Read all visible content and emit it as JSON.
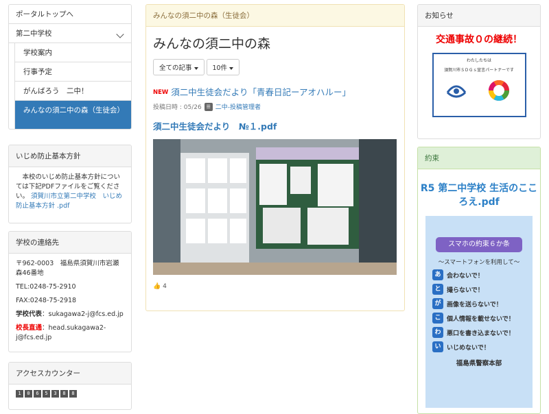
{
  "nav": {
    "portal": "ポータルトップへ",
    "school": "第二中学校",
    "items": [
      "学校案内",
      "行事予定",
      "がんばろう　二中！",
      "みんなの須二中の森（生徒会）"
    ]
  },
  "ijime": {
    "title": "いじめ防止基本方針",
    "text": "　本校のいじめ防止基本方針については下記PDFファイルをご覧ください。",
    "link": "須賀川市立第二中学校　いじめ防止基本方針 .pdf"
  },
  "contact": {
    "title": "学校の連絡先",
    "address": "〒962-0003　福島県須賀川市岩瀬森46番地",
    "tel": "TEL:0248-75-2910",
    "fax": "FAX:0248-75-2918",
    "rep_label": "学校代表",
    "rep_mail": "：sukagawa2-j@fcs.ed.jp",
    "head_label": "校長直通",
    "head_mail": "：head.sukagawa2-j@fcs.ed.jp"
  },
  "counter": {
    "title": "アクセスカウンター",
    "digits": [
      "1",
      "0",
      "6",
      "5",
      "3",
      "8",
      "8"
    ]
  },
  "main": {
    "breadcrumb": "みんなの須二中の森（生徒会）",
    "title": "みんなの須二中の森",
    "filter_all": "全ての記事",
    "filter_count": "10件",
    "new_badge": "NEW",
    "article_title": "須二中生徒会だより「青春日記ーアオハルー」",
    "posted": "投稿日時 : 05/26",
    "author": "二中-投稿管理者",
    "pdf": "須二中生徒会だより　№１.pdf",
    "likes": "4"
  },
  "notice": {
    "title": "お知らせ",
    "headline": "交通事故０の継続！",
    "sdgs_line1": "わたしたちは",
    "sdgs_line2": "須賀川市ＳＤＧｓ宣言パートナーです"
  },
  "promise": {
    "title": "約束",
    "headline": "R5 第二中学校 生活のこころえ.pdf",
    "card_head": "スマホの約束６か条",
    "card_sub": "～スマートフォンを利用して～",
    "rules": [
      {
        "k": "あ",
        "t": "会わないで！"
      },
      {
        "k": "と",
        "t": "撮らないで！"
      },
      {
        "k": "が",
        "t": "画像を送らないで！"
      },
      {
        "k": "こ",
        "t": "個人情報を載せないで！"
      },
      {
        "k": "わ",
        "t": "悪口を書き込まないで！"
      },
      {
        "k": "い",
        "t": "いじめないで！"
      }
    ],
    "police": "福島県警察本部"
  },
  "colors": {
    "primary": "#337ab7",
    "warning_head": "#fcf8e3",
    "success_head": "#dff0d8",
    "alert": "#ee0000"
  }
}
